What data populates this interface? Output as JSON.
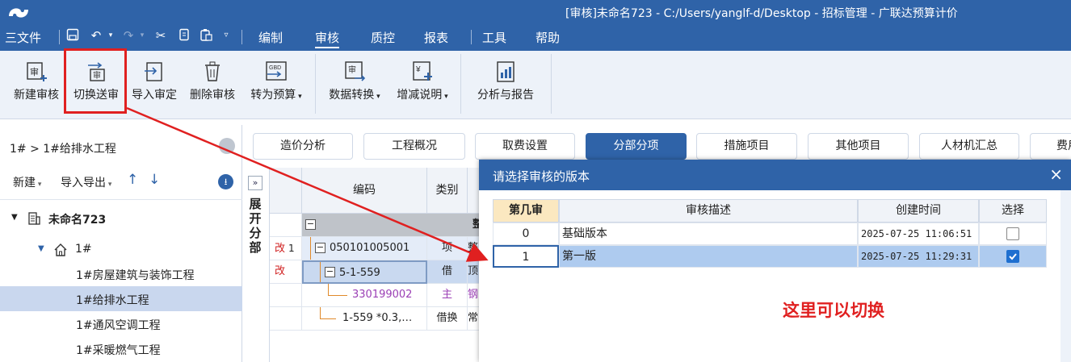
{
  "window": {
    "title": "[审核]未命名723 - C:/Users/yanglf-d/Desktop - 招标管理 - 广联达预算计价"
  },
  "menu": {
    "file": "三文件",
    "items": [
      "编制",
      "审核",
      "质控",
      "报表",
      "工具",
      "帮助"
    ],
    "active": "审核"
  },
  "ribbon": {
    "new_review": "新建审核",
    "switch_review": "切换送审",
    "import_review": "导入审定",
    "delete_review": "删除审核",
    "to_budget": "转为预算",
    "data_convert": "数据转换",
    "change_notes": "增减说明",
    "analysis_report": "分析与报告",
    "gbd_icon_text": "GBD"
  },
  "left_panel": {
    "breadcrumb": "1# > 1#给排水工程",
    "toolbar": {
      "new": "新建",
      "import_export": "导入导出"
    },
    "tree": [
      {
        "label": "未命名723"
      },
      {
        "label": "1#"
      },
      {
        "label": "1#房屋建筑与装饰工程"
      },
      {
        "label": "1#给排水工程"
      },
      {
        "label": "1#通风空调工程"
      },
      {
        "label": "1#采暖燃气工程"
      }
    ]
  },
  "tabs": [
    "造价分析",
    "工程概况",
    "取费设置",
    "分部分项",
    "措施项目",
    "其他项目",
    "人材机汇总",
    "费用"
  ],
  "active_tab": "分部分项",
  "grid": {
    "expand_label": "展开分部",
    "expand_btn": "»",
    "headers": {
      "code": "编码",
      "type": "类别"
    },
    "rows": [
      {
        "flag": "",
        "num": "",
        "code": "",
        "type": "",
        "extra": "整"
      },
      {
        "flag": "改",
        "num": "1",
        "code": "050101005001",
        "type": "项",
        "extra": "整"
      },
      {
        "flag": "改",
        "num": "",
        "code": "5-1-559",
        "type": "借",
        "extra": "顶"
      },
      {
        "flag": "",
        "num": "",
        "code": "330199002",
        "type": "主",
        "extra": "钢"
      },
      {
        "flag": "",
        "num": "",
        "code": "1-559 *0.3,…",
        "type": "借换",
        "extra": "常"
      }
    ]
  },
  "dialog": {
    "title": "请选择审核的版本",
    "close": "×",
    "headers": [
      "第几审",
      "审核描述",
      "创建时间",
      "选择"
    ],
    "rows": [
      {
        "num": "0",
        "desc": "基础版本",
        "time": "2025-07-25 11:06:51",
        "selected": false
      },
      {
        "num": "1",
        "desc": "第一版",
        "time": "2025-07-25 11:29:31",
        "selected": true
      }
    ],
    "note": "这里可以切换"
  },
  "colors": {
    "brand": "#2f63a8",
    "annotation": "#e02020",
    "selected_row": "#aecbef"
  }
}
